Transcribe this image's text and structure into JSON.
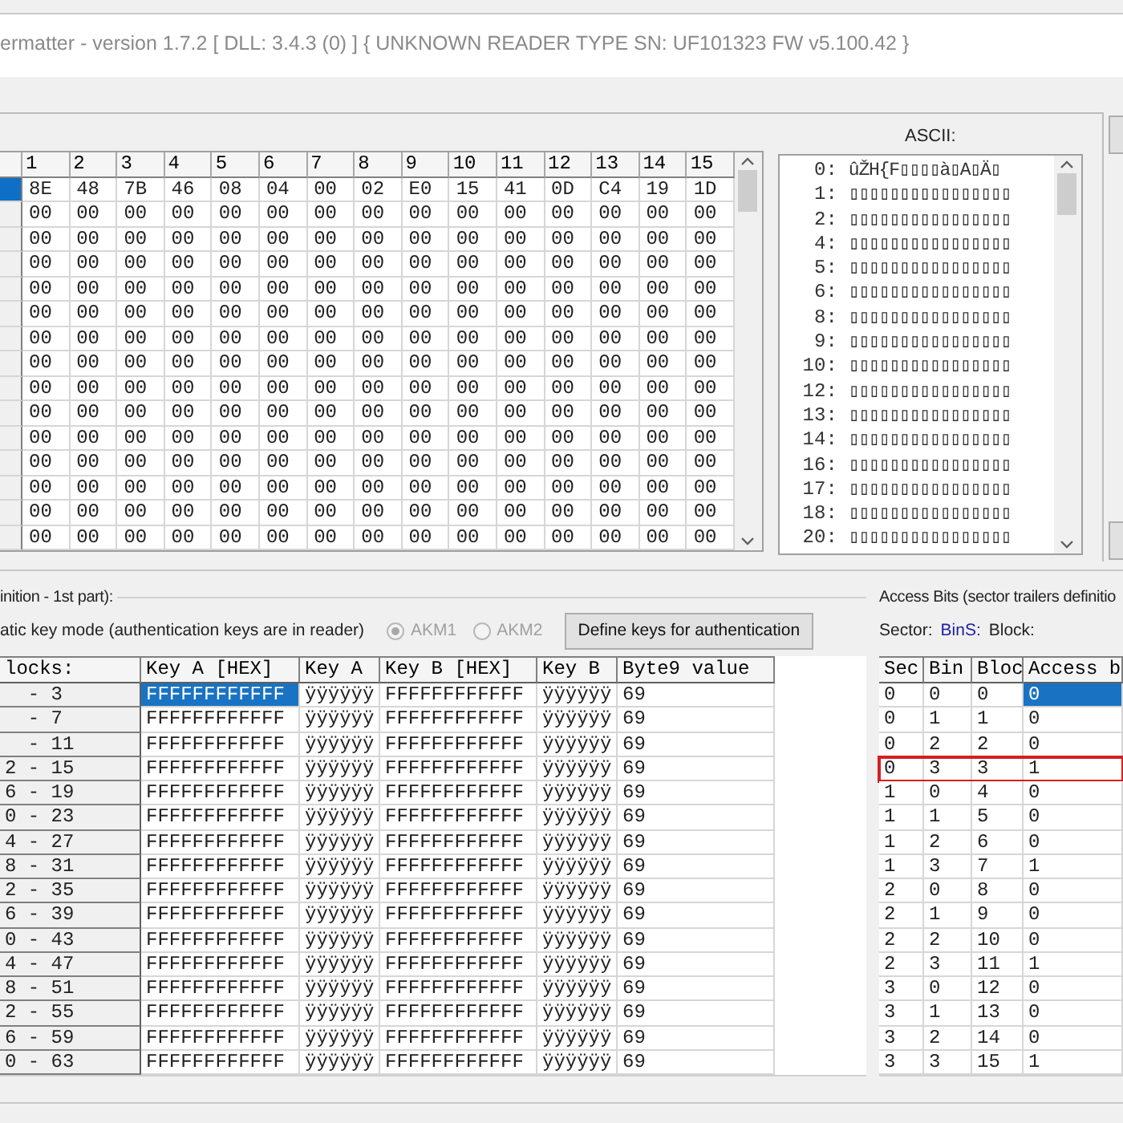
{
  "window": {
    "title": "ermatter - version 1.7.2 [ DLL: 3.4.3 (0) ] { UNKNOWN READER TYPE SN: UF101323 FW v5.100.42 }"
  },
  "hex_grid": {
    "columns": [
      "1",
      "2",
      "3",
      "4",
      "5",
      "6",
      "7",
      "8",
      "9",
      "10",
      "11",
      "12",
      "13",
      "14",
      "15"
    ],
    "rows": [
      {
        "selected": true,
        "cells": [
          "8E",
          "48",
          "7B",
          "46",
          "08",
          "04",
          "00",
          "02",
          "E0",
          "15",
          "41",
          "0D",
          "C4",
          "19",
          "1D"
        ]
      },
      {
        "selected": false,
        "cells": [
          "00",
          "00",
          "00",
          "00",
          "00",
          "00",
          "00",
          "00",
          "00",
          "00",
          "00",
          "00",
          "00",
          "00",
          "00"
        ]
      },
      {
        "selected": false,
        "cells": [
          "00",
          "00",
          "00",
          "00",
          "00",
          "00",
          "00",
          "00",
          "00",
          "00",
          "00",
          "00",
          "00",
          "00",
          "00"
        ]
      },
      {
        "selected": false,
        "cells": [
          "00",
          "00",
          "00",
          "00",
          "00",
          "00",
          "00",
          "00",
          "00",
          "00",
          "00",
          "00",
          "00",
          "00",
          "00"
        ]
      },
      {
        "selected": false,
        "cells": [
          "00",
          "00",
          "00",
          "00",
          "00",
          "00",
          "00",
          "00",
          "00",
          "00",
          "00",
          "00",
          "00",
          "00",
          "00"
        ]
      },
      {
        "selected": false,
        "cells": [
          "00",
          "00",
          "00",
          "00",
          "00",
          "00",
          "00",
          "00",
          "00",
          "00",
          "00",
          "00",
          "00",
          "00",
          "00"
        ]
      },
      {
        "selected": false,
        "cells": [
          "00",
          "00",
          "00",
          "00",
          "00",
          "00",
          "00",
          "00",
          "00",
          "00",
          "00",
          "00",
          "00",
          "00",
          "00"
        ]
      },
      {
        "selected": false,
        "cells": [
          "00",
          "00",
          "00",
          "00",
          "00",
          "00",
          "00",
          "00",
          "00",
          "00",
          "00",
          "00",
          "00",
          "00",
          "00"
        ]
      },
      {
        "selected": false,
        "cells": [
          "00",
          "00",
          "00",
          "00",
          "00",
          "00",
          "00",
          "00",
          "00",
          "00",
          "00",
          "00",
          "00",
          "00",
          "00"
        ]
      },
      {
        "selected": false,
        "cells": [
          "00",
          "00",
          "00",
          "00",
          "00",
          "00",
          "00",
          "00",
          "00",
          "00",
          "00",
          "00",
          "00",
          "00",
          "00"
        ]
      },
      {
        "selected": false,
        "cells": [
          "00",
          "00",
          "00",
          "00",
          "00",
          "00",
          "00",
          "00",
          "00",
          "00",
          "00",
          "00",
          "00",
          "00",
          "00"
        ]
      },
      {
        "selected": false,
        "cells": [
          "00",
          "00",
          "00",
          "00",
          "00",
          "00",
          "00",
          "00",
          "00",
          "00",
          "00",
          "00",
          "00",
          "00",
          "00"
        ]
      },
      {
        "selected": false,
        "cells": [
          "00",
          "00",
          "00",
          "00",
          "00",
          "00",
          "00",
          "00",
          "00",
          "00",
          "00",
          "00",
          "00",
          "00",
          "00"
        ]
      },
      {
        "selected": false,
        "cells": [
          "00",
          "00",
          "00",
          "00",
          "00",
          "00",
          "00",
          "00",
          "00",
          "00",
          "00",
          "00",
          "00",
          "00",
          "00"
        ]
      },
      {
        "selected": false,
        "cells": [
          "00",
          "00",
          "00",
          "00",
          "00",
          "00",
          "00",
          "00",
          "00",
          "00",
          "00",
          "00",
          "00",
          "00",
          "00"
        ]
      }
    ]
  },
  "ascii": {
    "label": "ASCII:",
    "lines": [
      {
        "index": "0:",
        "text": "ûŽH{F▯▯▯▯à▯A▯Ä▯"
      },
      {
        "index": "1:",
        "text": "▯▯▯▯▯▯▯▯▯▯▯▯▯▯▯▯"
      },
      {
        "index": "2:",
        "text": "▯▯▯▯▯▯▯▯▯▯▯▯▯▯▯▯"
      },
      {
        "index": "4:",
        "text": "▯▯▯▯▯▯▯▯▯▯▯▯▯▯▯▯"
      },
      {
        "index": "5:",
        "text": "▯▯▯▯▯▯▯▯▯▯▯▯▯▯▯▯"
      },
      {
        "index": "6:",
        "text": "▯▯▯▯▯▯▯▯▯▯▯▯▯▯▯▯"
      },
      {
        "index": "8:",
        "text": "▯▯▯▯▯▯▯▯▯▯▯▯▯▯▯▯"
      },
      {
        "index": "9:",
        "text": "▯▯▯▯▯▯▯▯▯▯▯▯▯▯▯▯"
      },
      {
        "index": "10:",
        "text": "▯▯▯▯▯▯▯▯▯▯▯▯▯▯▯▯"
      },
      {
        "index": "12:",
        "text": "▯▯▯▯▯▯▯▯▯▯▯▯▯▯▯▯"
      },
      {
        "index": "13:",
        "text": "▯▯▯▯▯▯▯▯▯▯▯▯▯▯▯▯"
      },
      {
        "index": "14:",
        "text": "▯▯▯▯▯▯▯▯▯▯▯▯▯▯▯▯"
      },
      {
        "index": "16:",
        "text": "▯▯▯▯▯▯▯▯▯▯▯▯▯▯▯▯"
      },
      {
        "index": "17:",
        "text": "▯▯▯▯▯▯▯▯▯▯▯▯▯▯▯▯"
      },
      {
        "index": "18:",
        "text": "▯▯▯▯▯▯▯▯▯▯▯▯▯▯▯▯"
      },
      {
        "index": "20:",
        "text": "▯▯▯▯▯▯▯▯▯▯▯▯▯▯▯▯"
      }
    ]
  },
  "keys_group": {
    "title": "inition - 1st part):",
    "mode_label": "atic key mode (authentication keys are in reader)",
    "radios": [
      {
        "label": "AKM1",
        "selected": true,
        "disabled": true
      },
      {
        "label": "AKM2",
        "selected": false,
        "disabled": true
      }
    ],
    "define_button": "Define keys for authentication",
    "columns": [
      "locks:",
      "Key A [HEX]",
      "Key A",
      "Key B [HEX]",
      "Key B",
      "Byte9 value"
    ],
    "rows": [
      {
        "blocks": "  - 3",
        "key_a_hex": "FFFFFFFFFFFF",
        "key_a": "ÿÿÿÿÿÿ",
        "key_b_hex": "FFFFFFFFFFFF",
        "key_b": "ÿÿÿÿÿÿ",
        "byte9": "69",
        "selected": true
      },
      {
        "blocks": "  - 7",
        "key_a_hex": "FFFFFFFFFFFF",
        "key_a": "ÿÿÿÿÿÿ",
        "key_b_hex": "FFFFFFFFFFFF",
        "key_b": "ÿÿÿÿÿÿ",
        "byte9": "69",
        "selected": false
      },
      {
        "blocks": "  - 11",
        "key_a_hex": "FFFFFFFFFFFF",
        "key_a": "ÿÿÿÿÿÿ",
        "key_b_hex": "FFFFFFFFFFFF",
        "key_b": "ÿÿÿÿÿÿ",
        "byte9": "69",
        "selected": false
      },
      {
        "blocks": "2 - 15",
        "key_a_hex": "FFFFFFFFFFFF",
        "key_a": "ÿÿÿÿÿÿ",
        "key_b_hex": "FFFFFFFFFFFF",
        "key_b": "ÿÿÿÿÿÿ",
        "byte9": "69",
        "selected": false
      },
      {
        "blocks": "6 - 19",
        "key_a_hex": "FFFFFFFFFFFF",
        "key_a": "ÿÿÿÿÿÿ",
        "key_b_hex": "FFFFFFFFFFFF",
        "key_b": "ÿÿÿÿÿÿ",
        "byte9": "69",
        "selected": false
      },
      {
        "blocks": "0 - 23",
        "key_a_hex": "FFFFFFFFFFFF",
        "key_a": "ÿÿÿÿÿÿ",
        "key_b_hex": "FFFFFFFFFFFF",
        "key_b": "ÿÿÿÿÿÿ",
        "byte9": "69",
        "selected": false
      },
      {
        "blocks": "4 - 27",
        "key_a_hex": "FFFFFFFFFFFF",
        "key_a": "ÿÿÿÿÿÿ",
        "key_b_hex": "FFFFFFFFFFFF",
        "key_b": "ÿÿÿÿÿÿ",
        "byte9": "69",
        "selected": false
      },
      {
        "blocks": "8 - 31",
        "key_a_hex": "FFFFFFFFFFFF",
        "key_a": "ÿÿÿÿÿÿ",
        "key_b_hex": "FFFFFFFFFFFF",
        "key_b": "ÿÿÿÿÿÿ",
        "byte9": "69",
        "selected": false
      },
      {
        "blocks": "2 - 35",
        "key_a_hex": "FFFFFFFFFFFF",
        "key_a": "ÿÿÿÿÿÿ",
        "key_b_hex": "FFFFFFFFFFFF",
        "key_b": "ÿÿÿÿÿÿ",
        "byte9": "69",
        "selected": false
      },
      {
        "blocks": "6 - 39",
        "key_a_hex": "FFFFFFFFFFFF",
        "key_a": "ÿÿÿÿÿÿ",
        "key_b_hex": "FFFFFFFFFFFF",
        "key_b": "ÿÿÿÿÿÿ",
        "byte9": "69",
        "selected": false
      },
      {
        "blocks": "0 - 43",
        "key_a_hex": "FFFFFFFFFFFF",
        "key_a": "ÿÿÿÿÿÿ",
        "key_b_hex": "FFFFFFFFFFFF",
        "key_b": "ÿÿÿÿÿÿ",
        "byte9": "69",
        "selected": false
      },
      {
        "blocks": "4 - 47",
        "key_a_hex": "FFFFFFFFFFFF",
        "key_a": "ÿÿÿÿÿÿ",
        "key_b_hex": "FFFFFFFFFFFF",
        "key_b": "ÿÿÿÿÿÿ",
        "byte9": "69",
        "selected": false
      },
      {
        "blocks": "8 - 51",
        "key_a_hex": "FFFFFFFFFFFF",
        "key_a": "ÿÿÿÿÿÿ",
        "key_b_hex": "FFFFFFFFFFFF",
        "key_b": "ÿÿÿÿÿÿ",
        "byte9": "69",
        "selected": false
      },
      {
        "blocks": "2 - 55",
        "key_a_hex": "FFFFFFFFFFFF",
        "key_a": "ÿÿÿÿÿÿ",
        "key_b_hex": "FFFFFFFFFFFF",
        "key_b": "ÿÿÿÿÿÿ",
        "byte9": "69",
        "selected": false
      },
      {
        "blocks": "6 - 59",
        "key_a_hex": "FFFFFFFFFFFF",
        "key_a": "ÿÿÿÿÿÿ",
        "key_b_hex": "FFFFFFFFFFFF",
        "key_b": "ÿÿÿÿÿÿ",
        "byte9": "69",
        "selected": false
      },
      {
        "blocks": "0 - 63",
        "key_a_hex": "FFFFFFFFFFFF",
        "key_a": "ÿÿÿÿÿÿ",
        "key_b_hex": "FFFFFFFFFFFF",
        "key_b": "ÿÿÿÿÿÿ",
        "byte9": "69",
        "selected": false
      }
    ]
  },
  "access_group": {
    "title": "Access Bits (sector trailers definitio",
    "sector_label": "Sector:",
    "bins_label": "BinS:",
    "block_label": "Block:",
    "columns": [
      "Sec",
      "Bin",
      "Bloc",
      "Access b"
    ],
    "rows": [
      {
        "sector": "0",
        "bins": "0",
        "block": "0",
        "access": "0",
        "selected": true,
        "highlighted": false
      },
      {
        "sector": "0",
        "bins": "1",
        "block": "1",
        "access": "0",
        "selected": false,
        "highlighted": false
      },
      {
        "sector": "0",
        "bins": "2",
        "block": "2",
        "access": "0",
        "selected": false,
        "highlighted": false
      },
      {
        "sector": "0",
        "bins": "3",
        "block": "3",
        "access": "1",
        "selected": false,
        "highlighted": true
      },
      {
        "sector": "1",
        "bins": "0",
        "block": "4",
        "access": "0",
        "selected": false,
        "highlighted": false
      },
      {
        "sector": "1",
        "bins": "1",
        "block": "5",
        "access": "0",
        "selected": false,
        "highlighted": false
      },
      {
        "sector": "1",
        "bins": "2",
        "block": "6",
        "access": "0",
        "selected": false,
        "highlighted": false
      },
      {
        "sector": "1",
        "bins": "3",
        "block": "7",
        "access": "1",
        "selected": false,
        "highlighted": false
      },
      {
        "sector": "2",
        "bins": "0",
        "block": "8",
        "access": "0",
        "selected": false,
        "highlighted": false
      },
      {
        "sector": "2",
        "bins": "1",
        "block": "9",
        "access": "0",
        "selected": false,
        "highlighted": false
      },
      {
        "sector": "2",
        "bins": "2",
        "block": "10",
        "access": "0",
        "selected": false,
        "highlighted": false
      },
      {
        "sector": "2",
        "bins": "3",
        "block": "11",
        "access": "1",
        "selected": false,
        "highlighted": false
      },
      {
        "sector": "3",
        "bins": "0",
        "block": "12",
        "access": "0",
        "selected": false,
        "highlighted": false
      },
      {
        "sector": "3",
        "bins": "1",
        "block": "13",
        "access": "0",
        "selected": false,
        "highlighted": false
      },
      {
        "sector": "3",
        "bins": "2",
        "block": "14",
        "access": "0",
        "selected": false,
        "highlighted": false
      },
      {
        "sector": "3",
        "bins": "3",
        "block": "15",
        "access": "1",
        "selected": false,
        "highlighted": false
      }
    ]
  }
}
